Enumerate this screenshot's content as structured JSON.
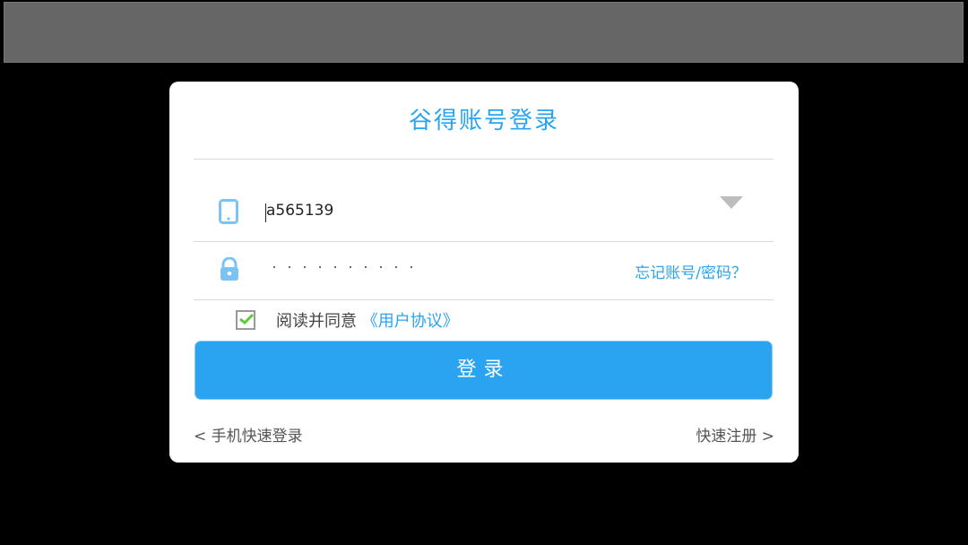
{
  "dialog": {
    "title": "谷得账号登录",
    "account_value": "a565139",
    "password_mask": "··········",
    "forgot_link": "忘记账号/密码？",
    "agree_prefix": "阅读并同意",
    "agreement_link": "《用户协议》",
    "agree_checked": true,
    "login_button": "登录",
    "phone_login_link": "< 手机快速登录",
    "register_link": "快速注册 >"
  },
  "icons": {
    "account": "phone-icon",
    "password": "lock-icon",
    "dropdown": "triangle-down-icon",
    "check": "checkmark-icon"
  },
  "colors": {
    "accent": "#2aa3f0",
    "icon_blue": "#7cc3f5",
    "check_green": "#5cc83c"
  }
}
